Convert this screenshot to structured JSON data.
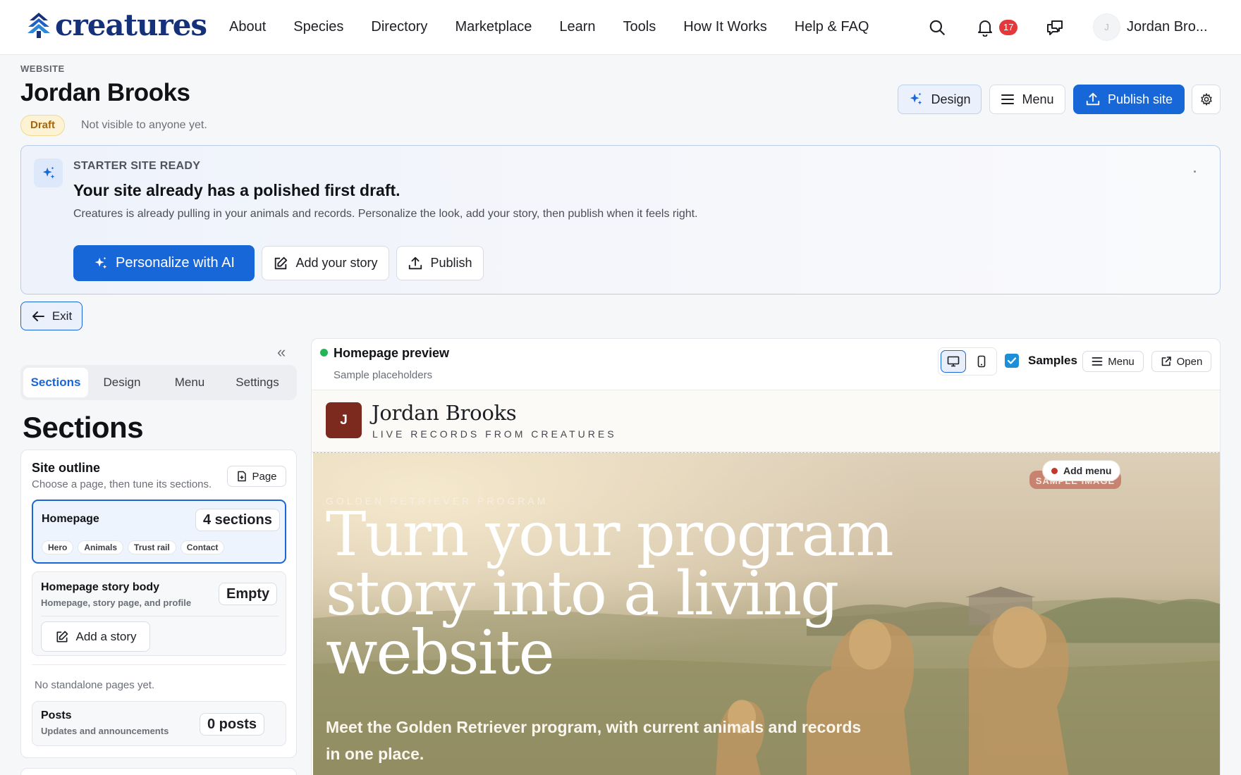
{
  "brand": {
    "name": "creatures",
    "color": "#15317a"
  },
  "nav": {
    "links": [
      "About",
      "Species",
      "Directory",
      "Marketplace",
      "Learn",
      "Tools",
      "How It Works",
      "Help & FAQ"
    ],
    "notifications_count": "17",
    "user_initial": "J",
    "user_name": "Jordan Bro..."
  },
  "header": {
    "eyebrow": "WEBSITE",
    "title": "Jordan Brooks",
    "status_badge": "Draft",
    "status_note": "Not visible to anyone yet.",
    "design_label": "Design",
    "menu_label": "Menu",
    "publish_label": "Publish site"
  },
  "banner": {
    "eyebrow": "STARTER SITE READY",
    "title": "Your site already has a polished first draft.",
    "text": "Creatures is already pulling in your animals and records. Personalize the look, add your story, then publish when it feels right.",
    "personalize_label": "Personalize with AI",
    "add_story_label": "Add your story",
    "publish_label": "Publish"
  },
  "exit_label": "Exit",
  "sidebar": {
    "tabs": [
      "Sections",
      "Design",
      "Menu",
      "Settings"
    ],
    "active_tab": "Sections",
    "heading": "Sections",
    "outline": {
      "title": "Site outline",
      "subtitle": "Choose a page, then tune its sections.",
      "page_button": "Page",
      "homepage": {
        "title": "Homepage",
        "count": "4 sections",
        "chips": [
          "Hero",
          "Animals",
          "Trust rail",
          "Contact"
        ]
      },
      "story": {
        "title": "Homepage story body",
        "subtitle": "Homepage, story page, and profile",
        "count": "Empty",
        "button": "Add a story"
      },
      "no_pages": "No standalone pages yet.",
      "posts": {
        "title": "Posts",
        "subtitle": "Updates and announcements",
        "count": "0 posts"
      }
    }
  },
  "preview": {
    "title": "Homepage preview",
    "subtitle": "Sample placeholders",
    "samples_label": "Samples",
    "samples_checked": true,
    "menu_label": "Menu",
    "open_label": "Open",
    "site": {
      "avatar_initial": "J",
      "name": "Jordan Brooks",
      "tagline": "LIVE RECORDS FROM CREATURES",
      "add_menu_label": "Add menu",
      "sample_tag": "SAMPLE IMAGE",
      "hero_eyebrow": "GOLDEN RETRIEVER PROGRAM",
      "hero_title": "Turn your program story into a living website",
      "hero_subtitle": "Meet the Golden Retriever program, with current animals and records in one place."
    }
  },
  "colors": {
    "accent": "#1767d8",
    "draft_bg": "#fdf3d4",
    "draft_text": "#a6650a",
    "live_dot": "#25b35a",
    "notification": "#e5383b",
    "site_avatar": "#7c2a1e"
  }
}
